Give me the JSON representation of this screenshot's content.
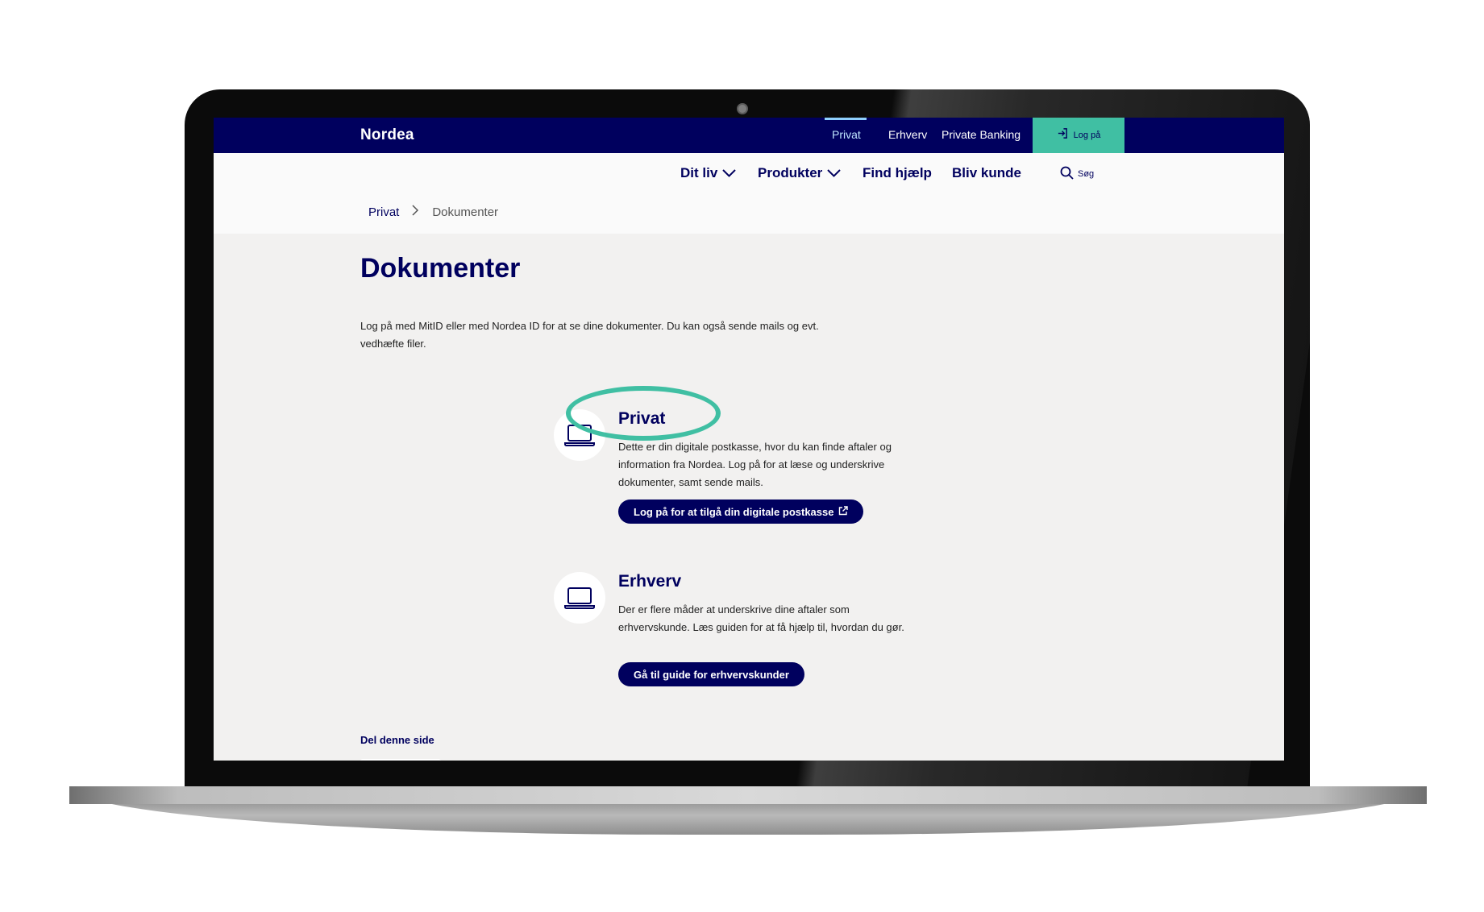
{
  "brand": {
    "name": "Nordea",
    "primary_color": "#00005e",
    "accent_color": "#40bfa3"
  },
  "topnav": {
    "items": [
      {
        "label": "Privat",
        "active": true
      },
      {
        "label": "Erhverv",
        "active": false
      },
      {
        "label": "Private Banking",
        "active": false
      }
    ],
    "login": {
      "label": "Log på",
      "icon": "login-icon"
    }
  },
  "mainnav": {
    "items": [
      {
        "label": "Dit liv",
        "icon": "chevron-down-icon"
      },
      {
        "label": "Produkter",
        "icon": "chevron-down-icon"
      },
      {
        "label": "Find hjælp"
      },
      {
        "label": "Bliv kunde"
      }
    ],
    "search": {
      "label": "Søg",
      "icon": "search-icon"
    }
  },
  "breadcrumb": {
    "items": [
      "Privat",
      "Dokumenter"
    ]
  },
  "page": {
    "title": "Dokumenter",
    "intro": "Log på med MitID eller med Nordea ID for at se dine dokumenter. Du kan også sende mails og evt. vedhæfte filer."
  },
  "cards": [
    {
      "title": "Privat",
      "text": "Dette er din digitale postkasse, hvor du kan finde aftaler og information fra Nordea. Log på for at læse og underskrive dokumenter, samt sende mails.",
      "button": "Log på for at tilgå din digitale postkasse",
      "icon": "laptop-icon",
      "button_icon": "external-link-icon",
      "highlighted": true
    },
    {
      "title": "Erhverv",
      "text": "Der er flere måder at underskrive dine aftaler som erhvervskunde. Læs guiden for at få hjælp til, hvordan du gør.",
      "button": "Gå til guide for erhvervskunder",
      "icon": "laptop-icon"
    }
  ],
  "footer": {
    "share_label": "Del denne side"
  }
}
